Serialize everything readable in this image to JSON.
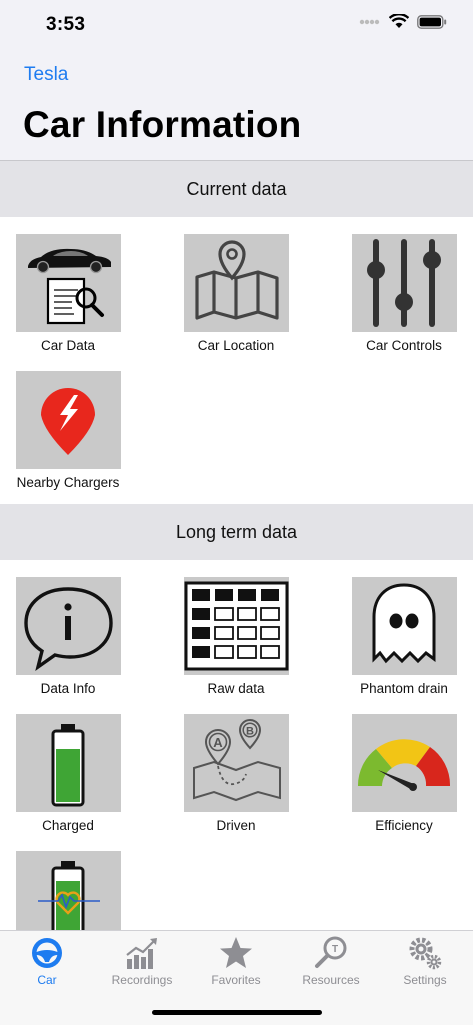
{
  "status": {
    "time": "3:53"
  },
  "nav": {
    "back_label": "Tesla",
    "title": "Car Information"
  },
  "sections": {
    "current": {
      "title": "Current data",
      "items": [
        {
          "label": "Car Data",
          "icon": "car-data-icon"
        },
        {
          "label": "Car Location",
          "icon": "map-pin-icon"
        },
        {
          "label": "Car Controls",
          "icon": "sliders-icon"
        },
        {
          "label": "Nearby Chargers",
          "icon": "charger-pin-icon"
        }
      ]
    },
    "longterm": {
      "title": "Long term data",
      "items": [
        {
          "label": "Data Info",
          "icon": "info-bubble-icon"
        },
        {
          "label": "Raw data",
          "icon": "grid-table-icon"
        },
        {
          "label": "Phantom drain",
          "icon": "ghost-icon"
        },
        {
          "label": "Charged",
          "icon": "battery-icon"
        },
        {
          "label": "Driven",
          "icon": "route-map-icon"
        },
        {
          "label": "Efficiency",
          "icon": "gauge-icon"
        },
        {
          "label": "",
          "icon": "battery-health-icon"
        }
      ]
    }
  },
  "tabs": [
    {
      "label": "Car",
      "icon": "steering-wheel-icon",
      "active": true
    },
    {
      "label": "Recordings",
      "icon": "chart-icon",
      "active": false
    },
    {
      "label": "Favorites",
      "icon": "star-icon",
      "active": false
    },
    {
      "label": "Resources",
      "icon": "magnifier-icon",
      "active": false
    },
    {
      "label": "Settings",
      "icon": "gears-icon",
      "active": false
    }
  ],
  "colors": {
    "accent": "#1e7cf0",
    "tile_bg": "#c9c9c9",
    "section_bg": "#e3e3e7",
    "charger_red": "#e8271d",
    "battery_green": "#3fa535"
  }
}
